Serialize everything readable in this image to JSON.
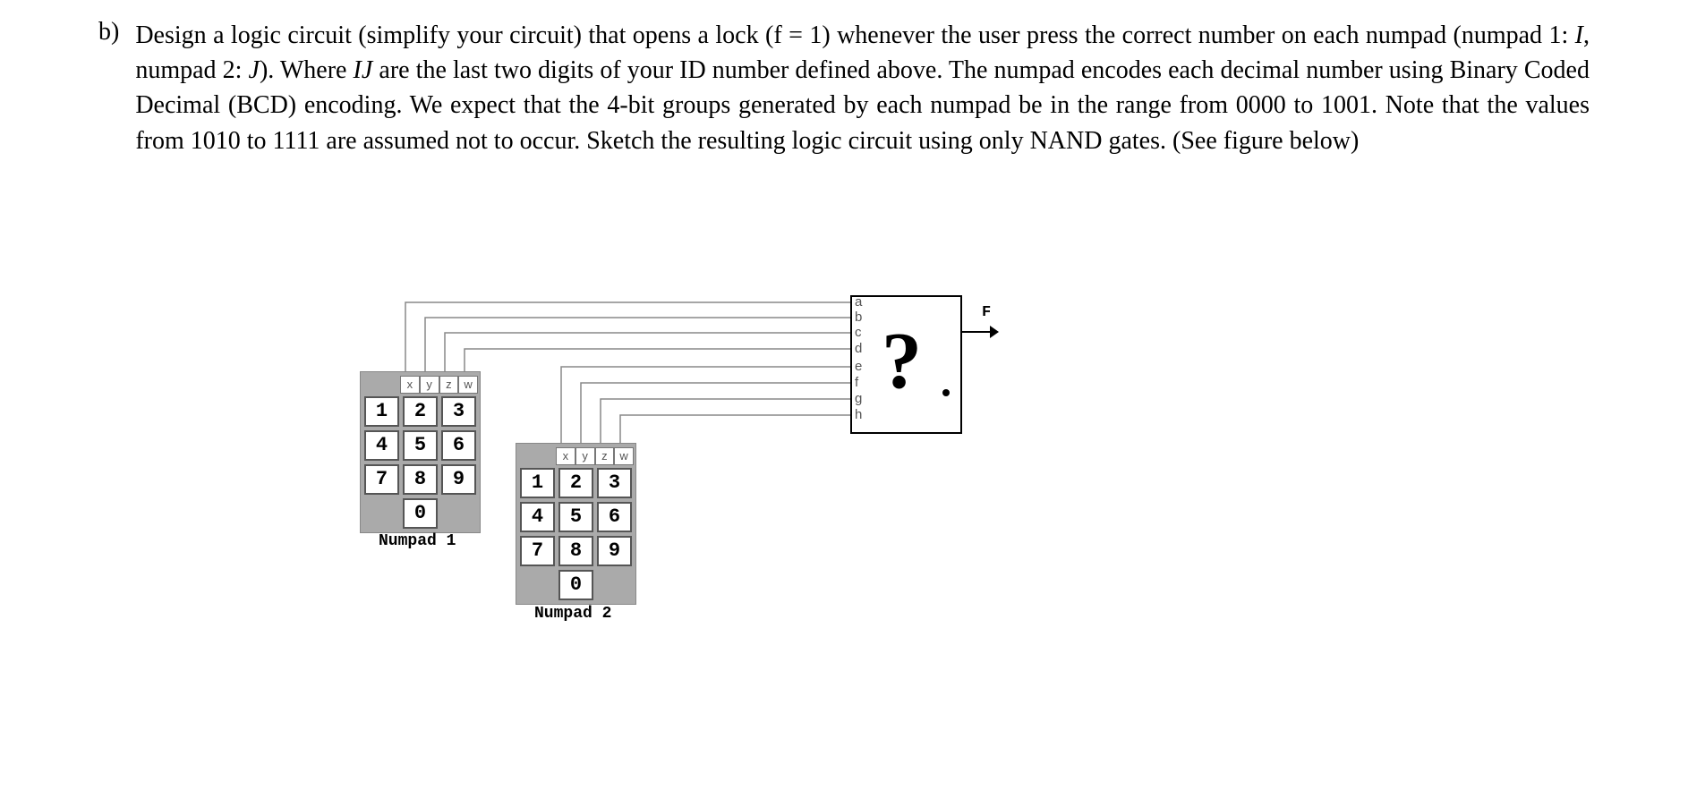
{
  "question": {
    "label": "b)",
    "text_segments": [
      {
        "t": "Design a logic circuit (simplify your circuit) that opens a lock (f = 1) whenever the user press the correct number on each numpad (numpad 1: ",
        "i": false
      },
      {
        "t": "I",
        "i": true
      },
      {
        "t": ", numpad 2: ",
        "i": false
      },
      {
        "t": "J",
        "i": true
      },
      {
        "t": "). Where ",
        "i": false
      },
      {
        "t": "IJ",
        "i": true
      },
      {
        "t": " are the last two digits of your ID number defined above. The numpad encodes each decimal number using Binary Coded Decimal (BCD) encoding. We expect that the 4-bit groups generated by each numpad be in the range from 0000 to 1001. Note that the values from 1010 to 1111 are assumed not to occur. Sketch the resulting logic circuit using only NAND gates. (See figure below)",
        "i": false
      }
    ]
  },
  "figure": {
    "numpad1": {
      "label": "Numpad 1",
      "bits": [
        "x",
        "y",
        "z",
        "w"
      ],
      "keys": [
        "1",
        "2",
        "3",
        "4",
        "5",
        "6",
        "7",
        "8",
        "9",
        "0"
      ]
    },
    "numpad2": {
      "label": "Numpad 2",
      "bits": [
        "x",
        "y",
        "z",
        "w"
      ],
      "keys": [
        "1",
        "2",
        "3",
        "4",
        "5",
        "6",
        "7",
        "8",
        "9",
        "0"
      ]
    },
    "circuit": {
      "pins": [
        "a",
        "b",
        "c",
        "d",
        "e",
        "f",
        "g",
        "h"
      ],
      "output": "F",
      "symbol": "?"
    }
  }
}
